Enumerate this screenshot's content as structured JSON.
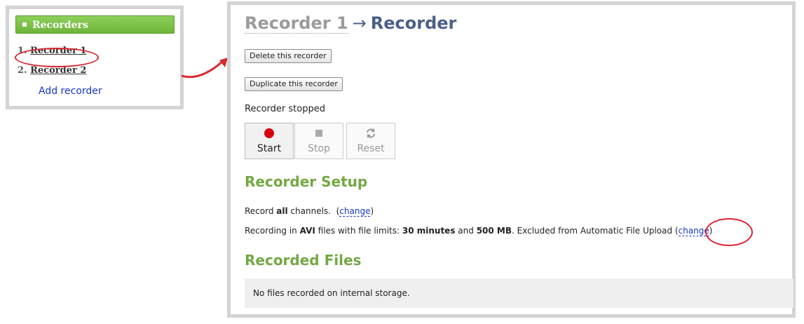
{
  "sidebar": {
    "header": "Recorders",
    "items": [
      {
        "num": "1.",
        "label": "Recorder 1"
      },
      {
        "num": "2.",
        "label": "Recorder 2"
      }
    ],
    "add_label": "Add recorder"
  },
  "main": {
    "breadcrumb_parent": "Recorder 1",
    "breadcrumb_sep": "→",
    "title": "Recorder",
    "delete_button": "Delete this recorder",
    "duplicate_button": "Duplicate this recorder",
    "status": "Recorder stopped",
    "controls": {
      "start": "Start",
      "stop": "Stop",
      "reset": "Reset"
    },
    "setup_heading": "Recorder Setup",
    "record_line": {
      "prefix": "Record ",
      "all": "all",
      "suffix": " channels.",
      "change": "change"
    },
    "format_line": {
      "p1": "Recording in ",
      "format": "AVI",
      "p2": " files with file limits: ",
      "time_limit": "30 minutes",
      "p3": " and ",
      "size_limit": "500 MB",
      "p4": ". Excluded from Automatic File Upload ",
      "change": "change"
    },
    "files_heading": "Recorded Files",
    "files_empty": "No files recorded on internal storage."
  },
  "colors": {
    "accent_green": "#73a843",
    "title_blue": "#4a5f8a",
    "link_blue": "#1a35c8",
    "highlight_red": "#d9262e",
    "record_red": "#d9000d"
  }
}
